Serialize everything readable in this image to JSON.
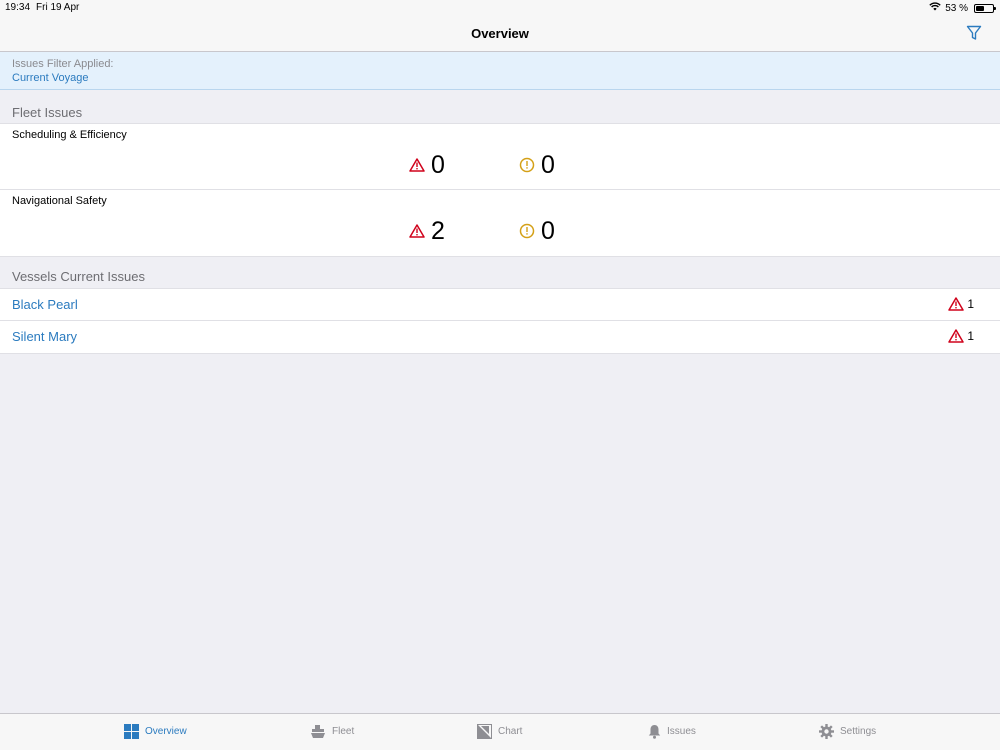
{
  "status_bar": {
    "time": "19:34",
    "date": "Fri 19 Apr",
    "battery": "53 %",
    "battery_level": 0.53
  },
  "nav": {
    "title": "Overview",
    "filter_icon": "filter-icon"
  },
  "filter_banner": {
    "label": "Issues Filter Applied:",
    "value": "Current Voyage"
  },
  "fleet_issues": {
    "header": "Fleet Issues",
    "rows": [
      {
        "title": "Scheduling & Efficiency",
        "alerts": "0",
        "warnings": "0"
      },
      {
        "title": "Navigational Safety",
        "alerts": "2",
        "warnings": "0"
      }
    ]
  },
  "vessels": {
    "header": "Vessels Current Issues",
    "items": [
      {
        "name": "Black Pearl",
        "alerts": "1"
      },
      {
        "name": "Silent Mary",
        "alerts": "1"
      }
    ]
  },
  "tabs": [
    {
      "label": "Overview",
      "icon": "grid-icon",
      "active": true
    },
    {
      "label": "Fleet",
      "icon": "ship-icon",
      "active": false
    },
    {
      "label": "Chart",
      "icon": "chart-icon",
      "active": false
    },
    {
      "label": "Issues",
      "icon": "bell-icon",
      "active": false
    },
    {
      "label": "Settings",
      "icon": "gear-icon",
      "active": false
    }
  ],
  "colors": {
    "accent": "#2b7bbf",
    "alert": "#d0021b",
    "warning": "#d4a017",
    "banner_bg": "#e4f1fc"
  }
}
